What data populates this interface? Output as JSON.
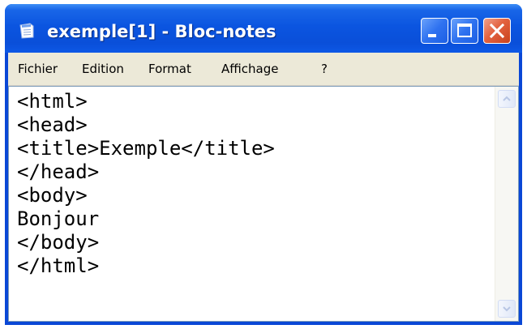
{
  "window": {
    "title": "exemple[1] - Bloc-notes",
    "title_bar_color": "#0a4fd9",
    "close_button_color": "#e3623f"
  },
  "icons": {
    "app": "notepad-icon",
    "minimize": "minimize-icon",
    "maximize": "maximize-icon",
    "close": "close-icon",
    "scroll_up": "chevron-up-icon",
    "scroll_down": "chevron-down-icon"
  },
  "menu": {
    "items": [
      {
        "label": "Fichier"
      },
      {
        "label": "Edition"
      },
      {
        "label": "Format"
      },
      {
        "label": "Affichage"
      },
      {
        "label": "?"
      }
    ]
  },
  "editor": {
    "lines": [
      "<html>",
      "<head>",
      "<title>Exemple</title>",
      "</head>",
      "<body>",
      "Bonjour",
      "</body>",
      "</html>"
    ]
  }
}
